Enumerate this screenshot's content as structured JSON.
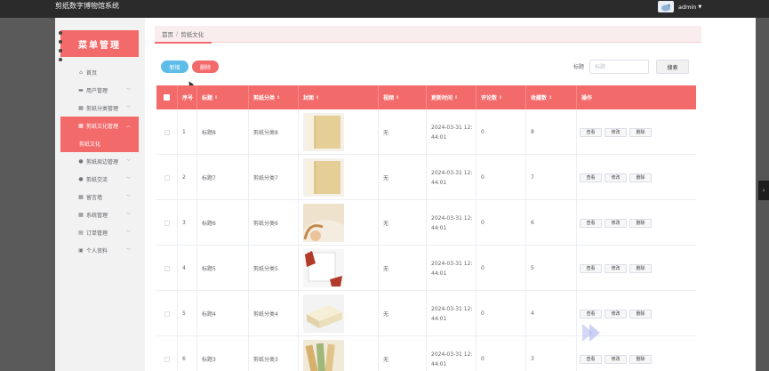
{
  "app": {
    "title": "剪纸数字博物馆系统",
    "user": "admin"
  },
  "sidebar": {
    "header": "菜单管理",
    "items": [
      {
        "icon": "home-icon",
        "glyph": "⌂",
        "label": "首页",
        "arrow": false
      },
      {
        "icon": "user-group-icon",
        "glyph": "▬",
        "label": "用户管理",
        "arrow": true
      },
      {
        "icon": "grid-icon",
        "glyph": "▦",
        "label": "剪纸分类管理",
        "arrow": true
      },
      {
        "icon": "grid-icon",
        "glyph": "▦",
        "label": "剪纸文化管理",
        "arrow": true,
        "active": true
      },
      {
        "icon": "person-icon",
        "glyph": "●",
        "label": "剪纸周边管理",
        "arrow": true
      },
      {
        "icon": "person-icon",
        "glyph": "●",
        "label": "剪纸交流",
        "arrow": true
      },
      {
        "icon": "grid-icon",
        "glyph": "▦",
        "label": "留言墙",
        "arrow": true
      },
      {
        "icon": "grid-icon",
        "glyph": "▦",
        "label": "系统管理",
        "arrow": true
      },
      {
        "icon": "cart-icon",
        "glyph": "▤",
        "label": "订单管理",
        "arrow": true
      },
      {
        "icon": "profile-icon",
        "glyph": "▣",
        "label": "个人资料",
        "arrow": true
      }
    ],
    "submenu": "剪纸文化"
  },
  "breadcrumb": {
    "home": "首页",
    "separator": "/",
    "current": "剪纸文化"
  },
  "toolbar": {
    "add_label": "新增",
    "delete_label": "删除",
    "search_label": "标题",
    "search_placeholder": "标题",
    "search_button": "搜索"
  },
  "table": {
    "headers": {
      "index": "序号",
      "title": "标题",
      "category": "剪纸分类",
      "cover": "封面",
      "video": "视频",
      "updated": "更新时间",
      "comments": "评论数",
      "favorites": "收藏数",
      "actions": "操作"
    },
    "rows": [
      {
        "index": "1",
        "title": "标题8",
        "category": "剪纸分类8",
        "cover": "paper-roll-light",
        "video": "无",
        "updated": "2024-03-31 12:\n44:01",
        "comments": "0",
        "favorites": "8"
      },
      {
        "index": "2",
        "title": "标题7",
        "category": "剪纸分类7",
        "cover": "paper-roll-light",
        "video": "无",
        "updated": "2024-03-31 12:\n44:01",
        "comments": "0",
        "favorites": "7"
      },
      {
        "index": "3",
        "title": "标题6",
        "category": "剪纸分类6",
        "cover": "paper-curl",
        "video": "无",
        "updated": "2024-03-31 12:\n44:01",
        "comments": "0",
        "favorites": "6"
      },
      {
        "index": "4",
        "title": "标题5",
        "category": "剪纸分类5",
        "cover": "paper-red-cut",
        "video": "无",
        "updated": "2024-03-31 12:\n44:01",
        "comments": "0",
        "favorites": "5"
      },
      {
        "index": "5",
        "title": "标题4",
        "category": "剪纸分类4",
        "cover": "paper-stack",
        "video": "无",
        "updated": "2024-03-31 12:\n44:01",
        "comments": "0",
        "favorites": "4"
      },
      {
        "index": "6",
        "title": "标题3",
        "category": "剪纸分类3",
        "cover": "paper-fan",
        "video": "无",
        "updated": "2024-03-31 12:\n44:01",
        "comments": "0",
        "favorites": "3"
      }
    ],
    "actions": {
      "view": "查看",
      "edit": "修改",
      "delete": "删除"
    }
  },
  "colors": {
    "accent": "#f36a6a",
    "primary_button": "#5dbde8",
    "topbar": "#2b2b2b"
  }
}
